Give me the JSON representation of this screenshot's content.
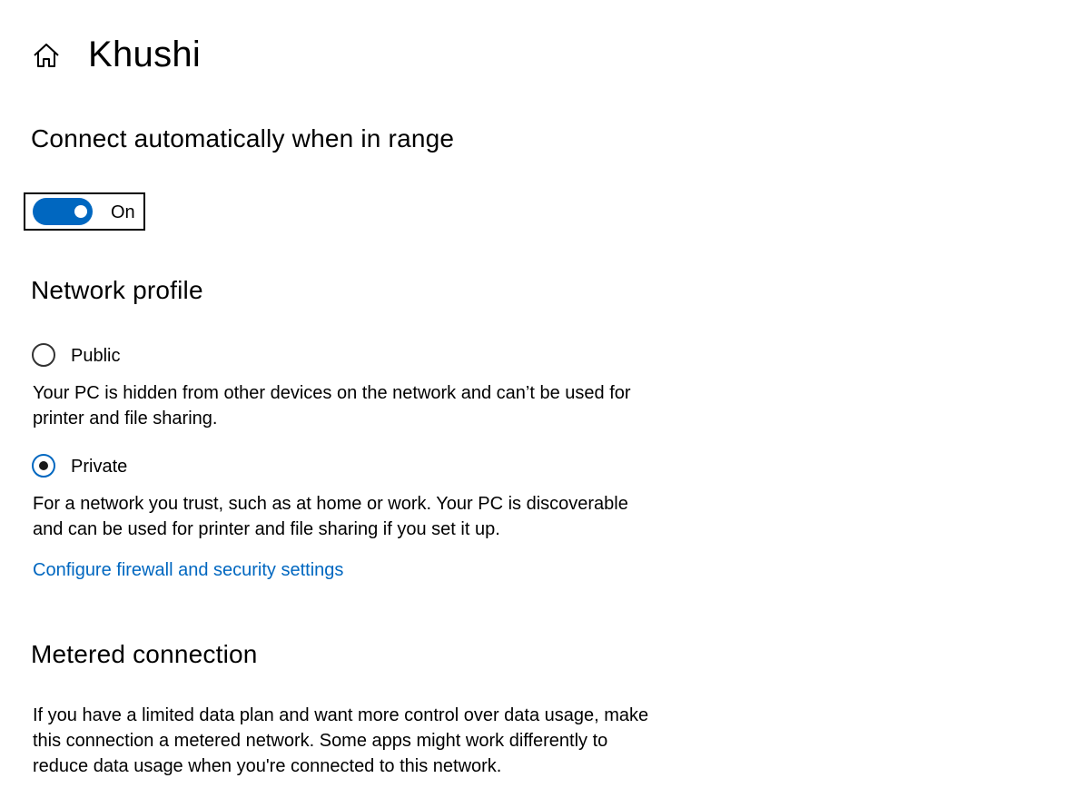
{
  "header": {
    "home_icon": "home-icon",
    "title": "Khushi"
  },
  "connect_auto": {
    "heading": "Connect automatically when in range",
    "toggle_state": "On",
    "toggle_on": true,
    "accent_color": "#0067c0"
  },
  "network_profile": {
    "heading": "Network profile",
    "options": [
      {
        "label": "Public",
        "selected": false,
        "description": "Your PC is hidden from other devices on the network and can’t be used for printer and file sharing."
      },
      {
        "label": "Private",
        "selected": true,
        "description": "For a network you trust, such as at home or work. Your PC is discoverable and can be used for printer and file sharing if you set it up."
      }
    ],
    "firewall_link": "Configure firewall and security settings"
  },
  "metered": {
    "heading": "Metered connection",
    "description": "If you have a limited data plan and want more control over data usage, make this connection a metered network. Some apps might work differently to reduce data usage when you're connected to this network."
  }
}
